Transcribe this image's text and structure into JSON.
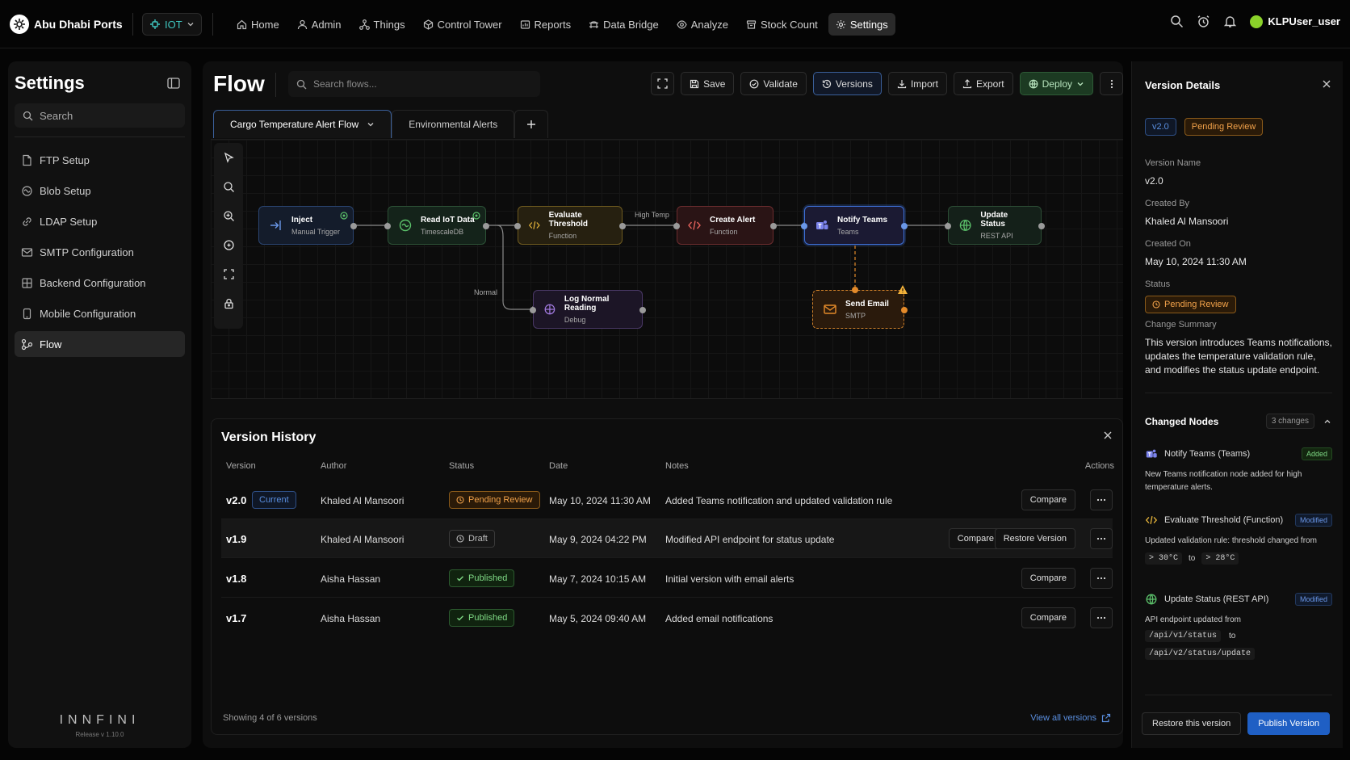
{
  "app": {
    "name": "Abu Dhabi Ports",
    "env": "IOT",
    "user": "KLPUser_user"
  },
  "nav": [
    {
      "label": "Home",
      "icon": "home-icon"
    },
    {
      "label": "Admin",
      "icon": "admin-icon"
    },
    {
      "label": "Things",
      "icon": "things-icon"
    },
    {
      "label": "Control Tower",
      "icon": "control-tower-icon"
    },
    {
      "label": "Reports",
      "icon": "reports-icon"
    },
    {
      "label": "Data Bridge",
      "icon": "data-bridge-icon"
    },
    {
      "label": "Analyze",
      "icon": "analyze-icon"
    },
    {
      "label": "Stock Count",
      "icon": "stock-count-icon"
    },
    {
      "label": "Settings",
      "icon": "gear-icon",
      "active": true
    }
  ],
  "sidebar": {
    "title": "Settings",
    "search_placeholder": "Search",
    "items": [
      {
        "label": "FTP Setup"
      },
      {
        "label": "Blob Setup"
      },
      {
        "label": "LDAP Setup"
      },
      {
        "label": "SMTP Configuration"
      },
      {
        "label": "Backend Configuration"
      },
      {
        "label": "Mobile Configuration"
      },
      {
        "label": "Flow",
        "active": true
      }
    ],
    "brand": "INNFINI",
    "release": "Release v 1.10.0"
  },
  "flow": {
    "title": "Flow",
    "search_placeholder": "Search flows...",
    "toolbar": {
      "save": "Save",
      "validate": "Validate",
      "versions": "Versions",
      "import": "Import",
      "export": "Export",
      "deploy": "Deploy"
    },
    "tabs": [
      {
        "label": "Cargo Temperature Alert Flow",
        "active": true
      },
      {
        "label": "Environmental Alerts"
      }
    ],
    "nodes": [
      {
        "title": "Inject",
        "sub": "Manual Trigger"
      },
      {
        "title": "Read IoT Data",
        "sub": "TimescaleDB"
      },
      {
        "title": "Evaluate Threshold",
        "sub": "Function"
      },
      {
        "title": "Create Alert",
        "sub": "Function"
      },
      {
        "title": "Notify Teams",
        "sub": "Teams"
      },
      {
        "title": "Update Status",
        "sub": "REST API"
      },
      {
        "title": "Log Normal Reading",
        "sub": "Debug"
      },
      {
        "title": "Send Email",
        "sub": "SMTP"
      }
    ],
    "edge_labels": {
      "high": "High Temp",
      "normal": "Normal"
    }
  },
  "history": {
    "title": "Version History",
    "columns": [
      "Version",
      "Author",
      "Status",
      "Date",
      "Notes",
      "Actions"
    ],
    "rows": [
      {
        "version": "v2.0",
        "current": "Current",
        "author": "Khaled Al Mansoori",
        "status": "Pending Review",
        "date": "May 10, 2024 11:30 AM",
        "notes": "Added Teams notification and updated validation rule",
        "compare": "Compare"
      },
      {
        "version": "v1.9",
        "author": "Khaled Al Mansoori",
        "status": "Draft",
        "date": "May 9, 2024 04:22 PM",
        "notes": "Modified API endpoint for status update",
        "compare": "Compare",
        "restore": "Restore Version"
      },
      {
        "version": "v1.8",
        "author": "Aisha Hassan",
        "status": "Published",
        "date": "May 7, 2024 10:15 AM",
        "notes": "Initial version with email alerts",
        "compare": "Compare"
      },
      {
        "version": "v1.7",
        "author": "Aisha Hassan",
        "status": "Published",
        "date": "May 5, 2024 09:40 AM",
        "notes": "Added email notifications",
        "compare": "Compare"
      }
    ],
    "footer": "Showing 4 of 6 versions",
    "view_all": "View all versions"
  },
  "details": {
    "title": "Version Details",
    "version_badge": "v2.0",
    "status_badge": "Pending Review",
    "version_name_label": "Version Name",
    "version_name": "v2.0",
    "created_by_label": "Created By",
    "created_by": "Khaled Al Mansoori",
    "created_on_label": "Created On",
    "created_on": "May 10, 2024 11:30 AM",
    "status_label": "Status",
    "status": "Pending Review",
    "summary_label": "Change Summary",
    "summary": "This version introduces Teams notifications, updates the temperature validation rule, and modifies the status update endpoint.",
    "changed_title": "Changed Nodes",
    "changed_count": "3 changes",
    "changes": [
      {
        "name": "Notify Teams (Teams)",
        "tag": "Added",
        "desc": "New Teams notification node added for high temperature alerts."
      },
      {
        "name": "Evaluate Threshold (Function)",
        "tag": "Modified",
        "desc": "Updated validation rule: threshold changed from",
        "from": "> 30°C",
        "to_word": "to",
        "to": "> 28°C"
      },
      {
        "name": "Update Status (REST API)",
        "tag": "Modified",
        "desc": "API endpoint updated from",
        "from": "/api/v1/status",
        "to_word": "to",
        "to": "/api/v2/status/update"
      }
    ],
    "restore": "Restore this version",
    "publish": "Publish Version"
  },
  "colors": {
    "accent": "#1f5fc4",
    "pending": "#f2a24a",
    "published": "#7fd985",
    "teal": "#3fc6c0"
  }
}
